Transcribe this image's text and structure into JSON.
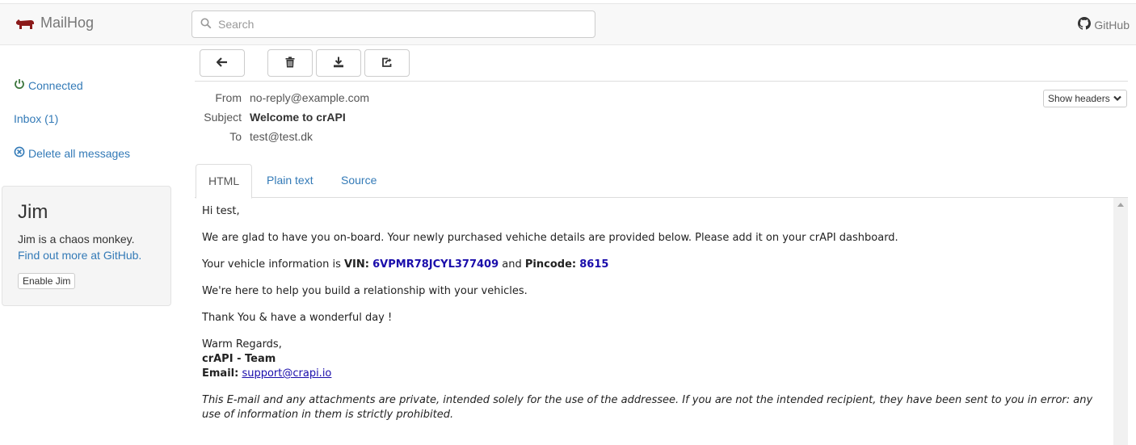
{
  "app": {
    "name": "MailHog",
    "github_label": "GitHub"
  },
  "search": {
    "placeholder": "Search"
  },
  "sidebar": {
    "connected": "Connected",
    "inbox": "Inbox (1)",
    "delete_all": "Delete all messages",
    "jim": {
      "title": "Jim",
      "description": "Jim is a chaos monkey.",
      "link": "Find out more at GitHub.",
      "button": "Enable Jim"
    }
  },
  "toolbar": {
    "icons": [
      "back-arrow-icon",
      "trash-icon",
      "download-icon",
      "release-icon"
    ]
  },
  "message": {
    "headers": [
      {
        "label": "From",
        "value": "no-reply@example.com"
      },
      {
        "label": "Subject",
        "value": "Welcome to crAPI"
      },
      {
        "label": "To",
        "value": "test@test.dk"
      }
    ],
    "show_headers": "Show headers"
  },
  "tabs": [
    {
      "label": "HTML",
      "active": true
    },
    {
      "label": "Plain text",
      "active": false
    },
    {
      "label": "Source",
      "active": false
    }
  ],
  "email": {
    "greeting": "Hi test,",
    "intro": "We are glad to have you on-board. Your newly purchased vehiche details are provided below. Please add it on your crAPI dashboard.",
    "vehicle_prefix": "Your vehicle information is ",
    "vin_label": "VIN:",
    "vin": "6VPMR78JCYL377409",
    "and": " and ",
    "pincode_label": "Pincode:",
    "pincode": "8615",
    "help": "We're here to help you build a relationship with your vehicles.",
    "thanks": "Thank You & have a wonderful day !",
    "regards": "Warm Regards,",
    "team": "crAPI - Team",
    "email_label": "Email:",
    "email_address": "support@crapi.io",
    "disclaimer": "This E-mail and any attachments are private, intended solely for the use of the addressee. If you are not the intended recipient, they have been sent to you in error: any use of information in them is strictly prohibited."
  },
  "colors": {
    "link": "#337ab7",
    "brand_icon": "#8b1a1a",
    "connected_icon": "#3c763d"
  }
}
